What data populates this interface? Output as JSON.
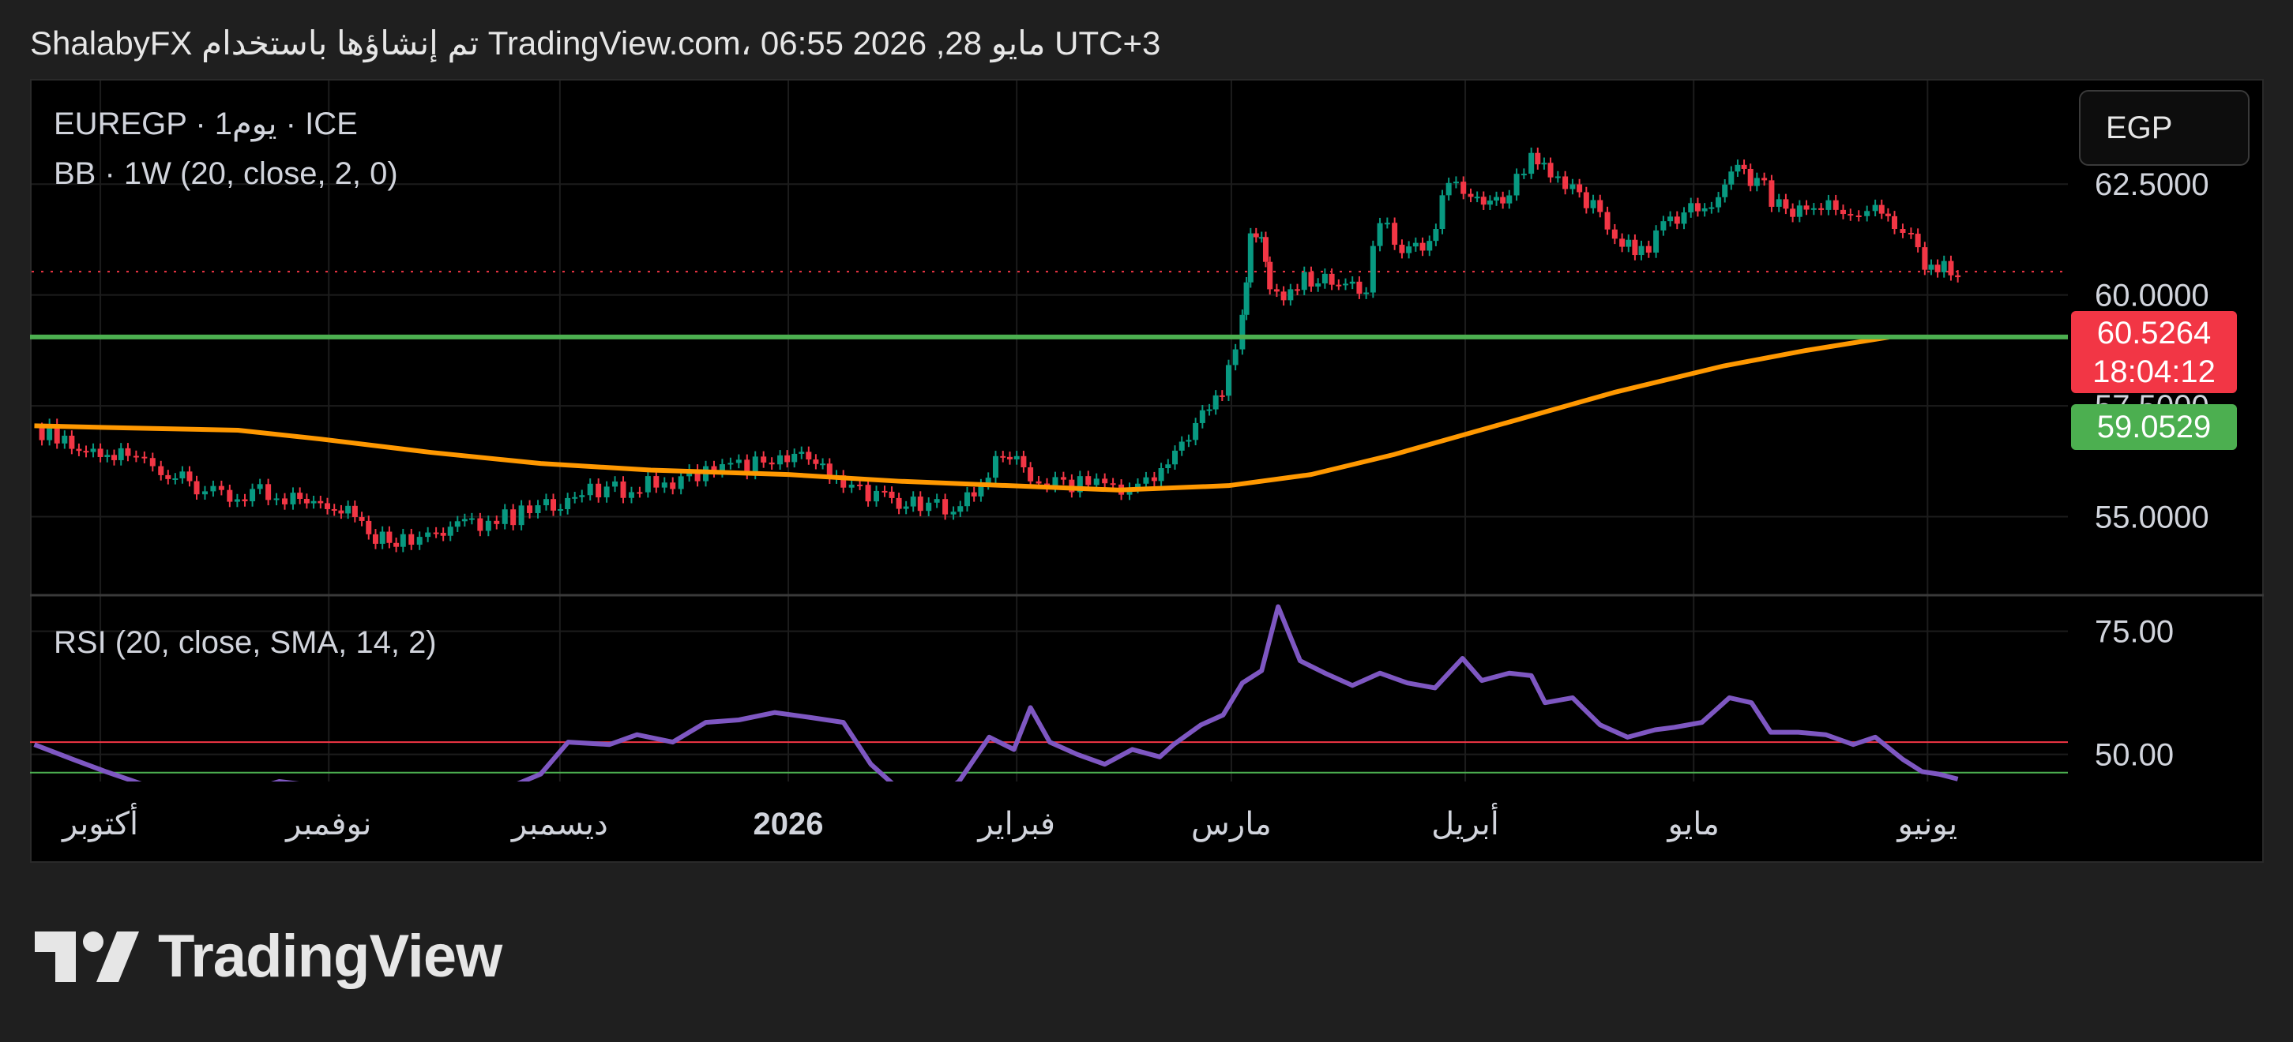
{
  "header": {
    "title": "ShalabyFX تم إنشاؤها باستخدام TradingView.com، 06:55 2026 ,28 مايو UTC+3"
  },
  "legend": {
    "symbol": "EUREGP · 1يوم · ICE",
    "bb": "BB · 1W (20, close, 2, 0)",
    "rsi": "RSI (20, close, SMA, 14, 2)"
  },
  "currency_button": "EGP",
  "price_tags": {
    "last_price": "60.5264",
    "countdown": "18:04:12",
    "support_level": "59.0529"
  },
  "colors": {
    "up": "#089981",
    "down": "#f23645",
    "bb_basis": "#ff9800",
    "support": "#4caf50",
    "rsi_line": "#7e57c2",
    "rsi_upper": "#f23645",
    "rsi_lower": "#4caf50",
    "price_tag_red": "#f23645",
    "price_tag_green": "#4caf50"
  },
  "footer": {
    "brand": "TradingView",
    "logo": "tradingview-logo-icon"
  },
  "chart_data": {
    "type": "candlestick",
    "symbol": "EUREGP",
    "price_axis": {
      "range": [
        53.3,
        64.8
      ],
      "tick_labels": [
        "55.0000",
        "57.5000",
        "60.0000",
        "62.5000"
      ]
    },
    "time_axis": {
      "labels": [
        {
          "text": "أكتوبر",
          "x": 2025.75,
          "bold": false
        },
        {
          "text": "نوفمبر",
          "x": 2025.833,
          "bold": false
        },
        {
          "text": "ديسمبر",
          "x": 2025.917,
          "bold": false
        },
        {
          "text": "2026",
          "x": 2026.0,
          "bold": true
        },
        {
          "text": "فبراير",
          "x": 2026.083,
          "bold": false
        },
        {
          "text": "مارس",
          "x": 2026.161,
          "bold": false
        },
        {
          "text": "أبريل",
          "x": 2026.246,
          "bold": false
        },
        {
          "text": "مايو",
          "x": 2026.329,
          "bold": false
        },
        {
          "text": "يونيو",
          "x": 2026.414,
          "bold": false
        }
      ],
      "range": [
        2025.725,
        2026.465
      ]
    },
    "closes": [
      [
        2025.726,
        57.0
      ],
      [
        2025.737,
        56.8
      ],
      [
        2025.75,
        56.2
      ],
      [
        2025.76,
        56.4
      ],
      [
        2025.772,
        56.1
      ],
      [
        2025.785,
        55.6
      ],
      [
        2025.797,
        55.35
      ],
      [
        2025.808,
        55.6
      ],
      [
        2025.82,
        55.4
      ],
      [
        2025.83,
        55.45
      ],
      [
        2025.84,
        55.2
      ],
      [
        2025.85,
        54.6
      ],
      [
        2025.86,
        54.5
      ],
      [
        2025.872,
        54.7
      ],
      [
        2025.885,
        54.85
      ],
      [
        2025.9,
        55.0
      ],
      [
        2025.912,
        55.3
      ],
      [
        2025.925,
        55.5
      ],
      [
        2025.94,
        55.6
      ],
      [
        2025.955,
        55.8
      ],
      [
        2025.97,
        56.0
      ],
      [
        2025.985,
        56.15
      ],
      [
        2025.997,
        56.2
      ],
      [
        2026.01,
        56.3
      ],
      [
        2026.02,
        55.8
      ],
      [
        2026.035,
        55.4
      ],
      [
        2026.048,
        55.2
      ],
      [
        2026.06,
        55.3
      ],
      [
        2026.07,
        55.7
      ],
      [
        2026.078,
        56.5
      ],
      [
        2026.088,
        55.9
      ],
      [
        2026.1,
        55.7
      ],
      [
        2026.112,
        55.8
      ],
      [
        2026.124,
        55.65
      ],
      [
        2026.133,
        55.85
      ],
      [
        2026.143,
        56.6
      ],
      [
        2026.153,
        57.4
      ],
      [
        2026.16,
        58.2
      ],
      [
        2026.165,
        59.5
      ],
      [
        2026.168,
        61.5
      ],
      [
        2026.172,
        61.3
      ],
      [
        2026.175,
        60.3
      ],
      [
        2026.18,
        60.0
      ],
      [
        2026.19,
        60.4
      ],
      [
        2026.2,
        60.2
      ],
      [
        2026.21,
        60.0
      ],
      [
        2026.215,
        61.8
      ],
      [
        2026.223,
        60.9
      ],
      [
        2026.233,
        61.1
      ],
      [
        2026.24,
        62.5
      ],
      [
        2026.248,
        62.2
      ],
      [
        2026.255,
        62.0
      ],
      [
        2026.262,
        62.3
      ],
      [
        2026.27,
        63.2
      ],
      [
        2026.277,
        62.6
      ],
      [
        2026.285,
        62.3
      ],
      [
        2026.295,
        61.8
      ],
      [
        2026.303,
        61.2
      ],
      [
        2026.31,
        61.0
      ],
      [
        2026.318,
        61.5
      ],
      [
        2026.328,
        61.9
      ],
      [
        2026.338,
        62.1
      ],
      [
        2026.345,
        62.8
      ],
      [
        2026.352,
        62.6
      ],
      [
        2026.36,
        62.0
      ],
      [
        2026.37,
        61.9
      ],
      [
        2026.378,
        62.1
      ],
      [
        2026.386,
        61.6
      ],
      [
        2026.395,
        61.9
      ],
      [
        2026.402,
        61.6
      ],
      [
        2026.408,
        61.2
      ],
      [
        2026.413,
        60.7
      ],
      [
        2026.42,
        60.55
      ],
      [
        2026.425,
        60.53
      ]
    ],
    "bb_basis": [
      [
        2025.726,
        57.05
      ],
      [
        2025.76,
        57.0
      ],
      [
        2025.8,
        56.95
      ],
      [
        2025.83,
        56.75
      ],
      [
        2025.87,
        56.45
      ],
      [
        2025.91,
        56.2
      ],
      [
        2025.95,
        56.05
      ],
      [
        2026.0,
        55.95
      ],
      [
        2026.04,
        55.8
      ],
      [
        2026.08,
        55.7
      ],
      [
        2026.12,
        55.6
      ],
      [
        2026.16,
        55.7
      ],
      [
        2026.19,
        55.95
      ],
      [
        2026.22,
        56.4
      ],
      [
        2026.26,
        57.1
      ],
      [
        2026.3,
        57.8
      ],
      [
        2026.34,
        58.4
      ],
      [
        2026.37,
        58.75
      ],
      [
        2026.4,
        59.05
      ]
    ],
    "support_level": 59.0529,
    "last_price": 60.5264,
    "rsi": {
      "range": [
        44.5,
        82.0
      ],
      "tick_labels": [
        "50.00",
        "75.00"
      ],
      "upper_band": 52.5,
      "lower_band": 46.3,
      "values": [
        [
          2025.726,
          52.0
        ],
        [
          2025.74,
          49.0
        ],
        [
          2025.752,
          46.5
        ],
        [
          2025.765,
          44.0
        ],
        [
          2025.78,
          42.5
        ],
        [
          2025.8,
          42.0
        ],
        [
          2025.815,
          44.5
        ],
        [
          2025.83,
          43.5
        ],
        [
          2025.845,
          42.0
        ],
        [
          2025.86,
          41.5
        ],
        [
          2025.88,
          44.0
        ],
        [
          2025.895,
          42.5
        ],
        [
          2025.91,
          46.0
        ],
        [
          2025.92,
          52.5
        ],
        [
          2025.935,
          52.0
        ],
        [
          2025.945,
          54.0
        ],
        [
          2025.958,
          52.5
        ],
        [
          2025.97,
          56.5
        ],
        [
          2025.982,
          57.0
        ],
        [
          2025.995,
          58.5
        ],
        [
          2026.008,
          57.5
        ],
        [
          2026.02,
          56.5
        ],
        [
          2026.03,
          48.0
        ],
        [
          2026.04,
          43.0
        ],
        [
          2026.05,
          40.0
        ],
        [
          2026.062,
          44.5
        ],
        [
          2026.073,
          53.5
        ],
        [
          2026.082,
          51.0
        ],
        [
          2026.088,
          59.5
        ],
        [
          2026.095,
          52.5
        ],
        [
          2026.105,
          50.0
        ],
        [
          2026.115,
          48.0
        ],
        [
          2026.125,
          51.0
        ],
        [
          2026.135,
          49.5
        ],
        [
          2026.14,
          52.0
        ],
        [
          2026.15,
          56.0
        ],
        [
          2026.158,
          58.0
        ],
        [
          2026.165,
          64.5
        ],
        [
          2026.172,
          67.0
        ],
        [
          2026.178,
          80.0
        ],
        [
          2026.186,
          69.0
        ],
        [
          2026.195,
          66.5
        ],
        [
          2026.205,
          64.0
        ],
        [
          2026.215,
          66.5
        ],
        [
          2026.225,
          64.5
        ],
        [
          2026.235,
          63.5
        ],
        [
          2026.245,
          69.5
        ],
        [
          2026.252,
          65.0
        ],
        [
          2026.262,
          66.5
        ],
        [
          2026.27,
          66.0
        ],
        [
          2026.275,
          60.5
        ],
        [
          2026.285,
          61.5
        ],
        [
          2026.295,
          56.0
        ],
        [
          2026.305,
          53.5
        ],
        [
          2026.315,
          55.0
        ],
        [
          2026.322,
          55.5
        ],
        [
          2026.332,
          56.5
        ],
        [
          2026.342,
          61.5
        ],
        [
          2026.35,
          60.5
        ],
        [
          2026.357,
          54.5
        ],
        [
          2026.367,
          54.5
        ],
        [
          2026.377,
          54.0
        ],
        [
          2026.387,
          52.0
        ],
        [
          2026.395,
          53.5
        ],
        [
          2026.405,
          49.0
        ],
        [
          2026.412,
          46.5
        ],
        [
          2026.418,
          46.0
        ],
        [
          2026.425,
          45.0
        ]
      ]
    }
  }
}
